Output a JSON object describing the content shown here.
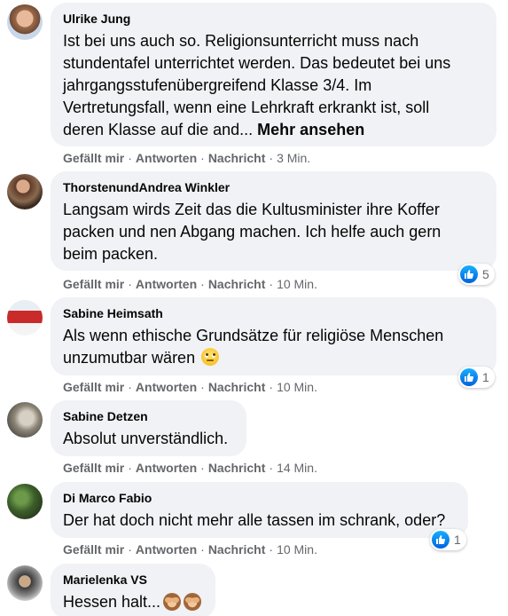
{
  "actions": {
    "like": "Gefällt mir",
    "reply": "Antworten",
    "message": "Nachricht",
    "separator": "·"
  },
  "comments": [
    {
      "author": "Ulrike Jung",
      "lines": [
        "Ist bei uns auch so. Religionsunterricht muss nach",
        "stundentafel unterrichtet werden. Das bedeutet bei uns",
        "jahrgangsstufenübergreifend Klasse 3/4. Im",
        "Vertretungsfall, wenn eine Lehrkraft erkrankt ist, soll",
        "deren Klasse auf die and..."
      ],
      "see_more": "Mehr ansehen",
      "time": "3 Min."
    },
    {
      "author": "ThorstenundAndrea Winkler",
      "lines": [
        "Langsam wirds Zeit das die Kultusminister ihre Koffer",
        "packen und nen Abgang machen. Ich helfe auch gern",
        "beim packen."
      ],
      "time": "10 Min.",
      "reaction_count": "5"
    },
    {
      "author": "Sabine Heimsath",
      "lines": [
        "Als wenn ethische Grundsätze für religiöse Menschen",
        "unzumutbar wären"
      ],
      "emoji": "eye-roll-emoji",
      "time": "10 Min.",
      "reaction_count": "1"
    },
    {
      "author": "Sabine Detzen",
      "lines": [
        "Absolut unverständlich."
      ],
      "time": "14 Min."
    },
    {
      "author": "Di Marco Fabio",
      "lines": [
        "Der hat doch nicht mehr alle tassen im schrank, oder?"
      ],
      "time": "10 Min.",
      "reaction_count": "1"
    },
    {
      "author": "Marielenka VS",
      "lines": [
        "Hessen halt..."
      ],
      "emoji": "see-no-evil-monkey-emoji"
    }
  ],
  "colors": {
    "bubble": "#f0f2f5",
    "like_blue": "#1877f2",
    "meta_gray": "#65676b"
  }
}
